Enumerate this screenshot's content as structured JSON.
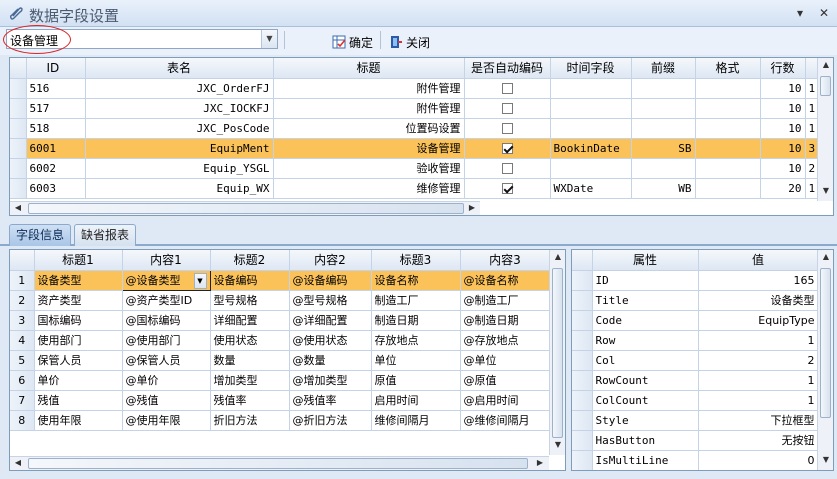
{
  "window": {
    "title": "数据字段设置",
    "minimize": "▾",
    "close": "✕"
  },
  "toolbar": {
    "combo_value": "设备管理",
    "confirm_label": "确定",
    "close_label": "关闭"
  },
  "top_grid": {
    "columns": [
      "ID",
      "表名",
      "标题",
      "是否自动编码",
      "时间字段",
      "前缀",
      "格式",
      "行数"
    ],
    "rows": [
      {
        "id": "516",
        "table": "JXC_OrderFJ",
        "title": "附件管理",
        "auto": false,
        "time": "",
        "prefix": "",
        "format": "",
        "rows": "10",
        "extra": "1"
      },
      {
        "id": "517",
        "table": "JXC_IOCKFJ",
        "title": "附件管理",
        "auto": false,
        "time": "",
        "prefix": "",
        "format": "",
        "rows": "10",
        "extra": "1"
      },
      {
        "id": "518",
        "table": "JXC_PosCode",
        "title": "位置码设置",
        "auto": false,
        "time": "",
        "prefix": "",
        "format": "",
        "rows": "10",
        "extra": "1"
      },
      {
        "id": "6001",
        "table": "EquipMent",
        "title": "设备管理",
        "auto": true,
        "time": "BookinDate",
        "prefix": "SB",
        "format": "",
        "rows": "10",
        "extra": "3"
      },
      {
        "id": "6002",
        "table": "Equip_YSGL",
        "title": "验收管理",
        "auto": false,
        "time": "",
        "prefix": "",
        "format": "",
        "rows": "10",
        "extra": "2"
      },
      {
        "id": "6003",
        "table": "Equip_WX",
        "title": "维修管理",
        "auto": true,
        "time": "WXDate",
        "prefix": "WB",
        "format": "",
        "rows": "20",
        "extra": "1"
      }
    ]
  },
  "tabs": [
    {
      "label": "字段信息"
    },
    {
      "label": "缺省报表"
    }
  ],
  "field_grid": {
    "columns": [
      "标题1",
      "内容1",
      "标题2",
      "内容2",
      "标题3",
      "内容3"
    ],
    "rows": [
      {
        "n": "1",
        "cells": [
          "设备类型",
          "@设备类型",
          "设备编码",
          "@设备编码",
          "设备名称",
          "@设备名称"
        ]
      },
      {
        "n": "2",
        "cells": [
          "资产类型",
          "@资产类型ID",
          "型号规格",
          "@型号规格",
          "制造工厂",
          "@制造工厂"
        ]
      },
      {
        "n": "3",
        "cells": [
          "国标编码",
          "@国标编码",
          "详细配置",
          "@详细配置",
          "制造日期",
          "@制造日期"
        ]
      },
      {
        "n": "4",
        "cells": [
          "使用部门",
          "@使用部门",
          "使用状态",
          "@使用状态",
          "存放地点",
          "@存放地点"
        ]
      },
      {
        "n": "5",
        "cells": [
          "保管人员",
          "@保管人员",
          "数量",
          "@数量",
          "单位",
          "@单位"
        ]
      },
      {
        "n": "6",
        "cells": [
          "单价",
          "@单价",
          "增加类型",
          "@增加类型",
          "原值",
          "@原值"
        ]
      },
      {
        "n": "7",
        "cells": [
          "残值",
          "@残值",
          "残值率",
          "@残值率",
          "启用时间",
          "@启用时间"
        ]
      },
      {
        "n": "8",
        "cells": [
          "使用年限",
          "@使用年限",
          "折旧方法",
          "@折旧方法",
          "维修间隔月",
          "@维修间隔月"
        ]
      }
    ]
  },
  "prop_grid": {
    "columns": [
      "属性",
      "值"
    ],
    "rows": [
      {
        "k": "ID",
        "v": "165"
      },
      {
        "k": "Title",
        "v": "设备类型"
      },
      {
        "k": "Code",
        "v": "EquipType"
      },
      {
        "k": "Row",
        "v": "1"
      },
      {
        "k": "Col",
        "v": "2"
      },
      {
        "k": "RowCount",
        "v": "1"
      },
      {
        "k": "ColCount",
        "v": "1"
      },
      {
        "k": "Style",
        "v": "下拉框型"
      },
      {
        "k": "HasButton",
        "v": "无按钮"
      },
      {
        "k": "IsMultiLine",
        "v": "0"
      }
    ]
  },
  "colors": {
    "selection": "#fbc25a",
    "accent": "#8aa9cd"
  }
}
